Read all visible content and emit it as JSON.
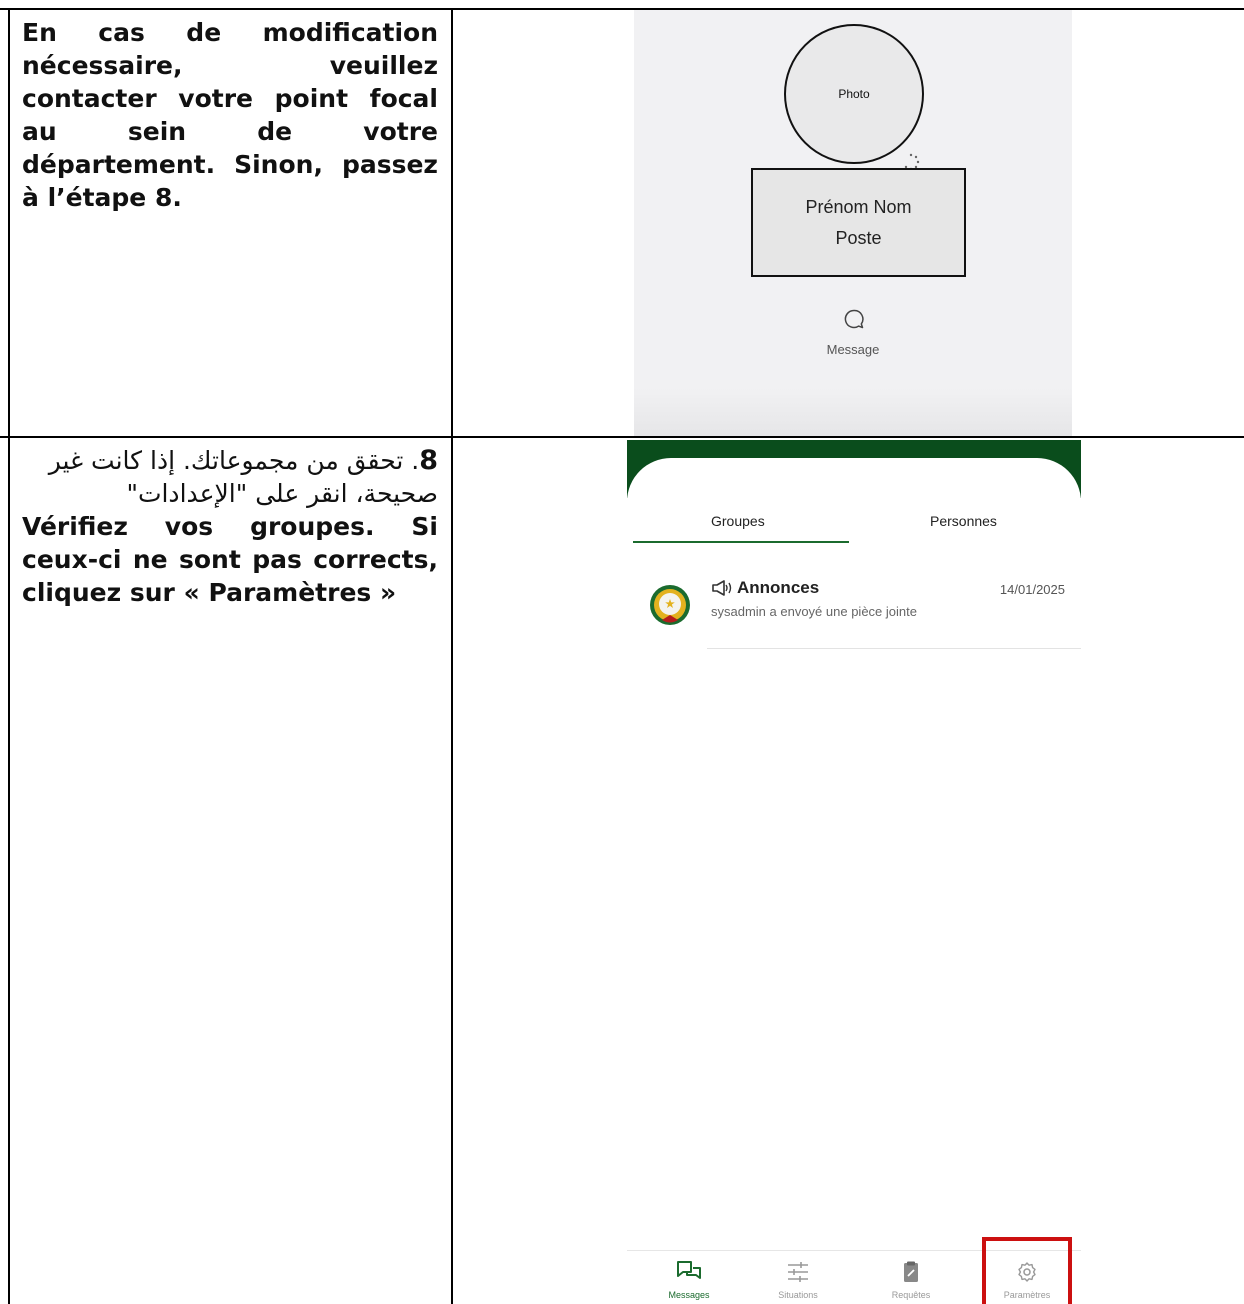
{
  "row1": {
    "text_plain": "En cas de modification nécessaire, veuillez contacter votre point focal au sein de votre département.",
    "text_bold": "Sinon, passez à l’étape 8.",
    "screenshot": {
      "photo_label": "Photo",
      "name_line1": "Prénom Nom",
      "name_line2": "Poste",
      "message_label": "Message",
      "message_icon": "chat-bubble-icon"
    }
  },
  "row2": {
    "arabic_number": "8",
    "arabic_text": ". تحقق من مجموعاتك. إذا كانت غير صحيحة، انقر على \"الإعدادات\"",
    "fr_plain": "Vérifiez vos groupes. Si ceux-ci ne sont pas corrects, cliquez sur « ",
    "fr_bold": "Paramètres",
    "fr_end": " »",
    "screenshot": {
      "tabs": [
        "Groupes",
        "Personnes"
      ],
      "active_tab": "Groupes",
      "group": {
        "title": "Annonces",
        "title_icon": "megaphone-icon",
        "subtitle": "sysadmin a envoyé une pièce jointe",
        "date": "14/01/2025"
      },
      "nav": [
        {
          "label": "Messages",
          "icon": "messages-icon",
          "active": true
        },
        {
          "label": "Situations",
          "icon": "sliders-icon",
          "active": false
        },
        {
          "label": "Requêtes",
          "icon": "clipboard-icon",
          "active": false
        },
        {
          "label": "Paramètres",
          "icon": "gear-icon",
          "active": false,
          "highlighted": true
        }
      ],
      "colors": {
        "header_green": "#0a4d1c",
        "accent_green": "#1b6b2e",
        "highlight_red": "#cc1010"
      }
    }
  }
}
